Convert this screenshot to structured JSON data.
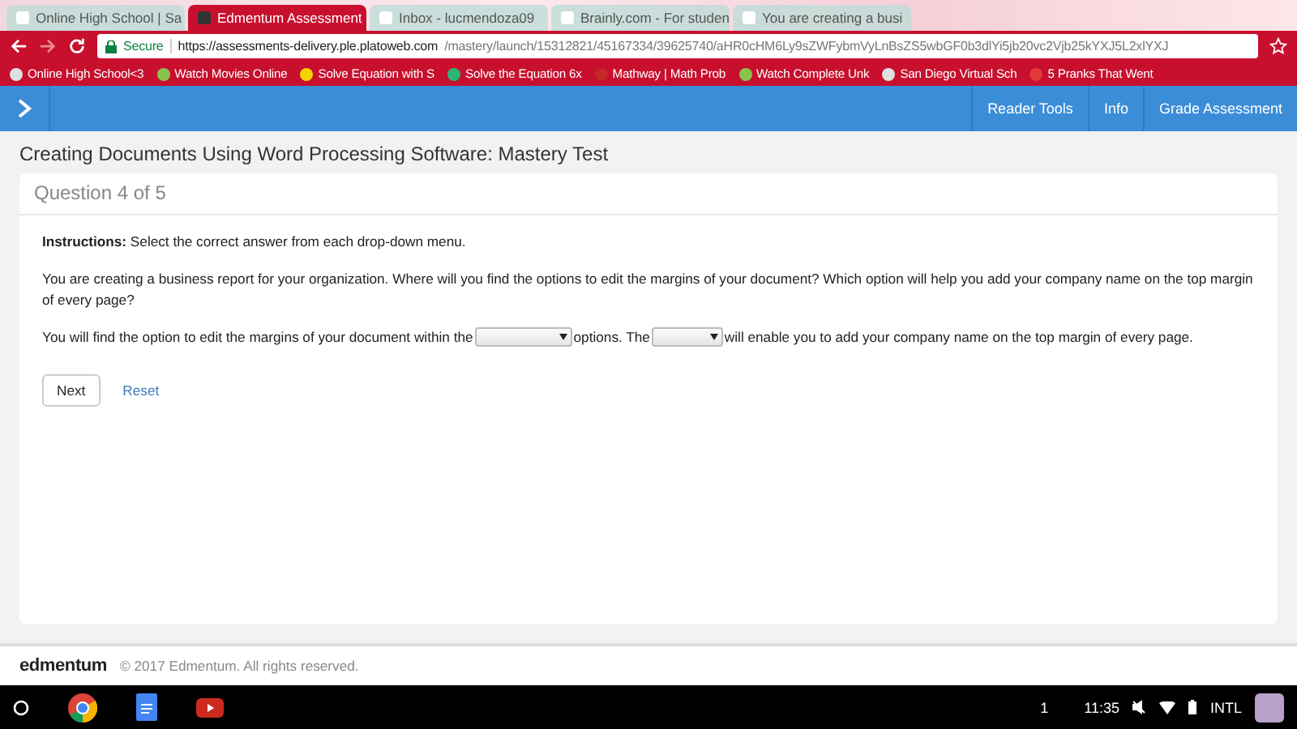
{
  "browser": {
    "tabs": [
      {
        "title": "Online High School | Sa",
        "selected": false
      },
      {
        "title": "Edmentum Assessment",
        "selected": true
      },
      {
        "title": "Inbox - lucmendoza09",
        "selected": false
      },
      {
        "title": "Brainly.com - For studen",
        "selected": false
      },
      {
        "title": "You are creating a busi",
        "selected": false
      }
    ],
    "secure_label": "Secure",
    "url_host": "https://assessments-delivery.ple.platoweb.com",
    "url_path": "/mastery/launch/15312821/45167334/39625740/aHR0cHM6Ly9sZWFybmVyLnBsZS5wbGF0b3dlYi5jb20vc2Vjb25kYXJ5L2xlYXJ",
    "bookmarks": [
      {
        "label": "Online High School<3",
        "color": "#e0e0e0"
      },
      {
        "label": "Watch Movies Online",
        "color": "#8bc34a"
      },
      {
        "label": "Solve Equation with S",
        "color": "#f5d300"
      },
      {
        "label": "Solve the Equation 6x",
        "color": "#2bb673"
      },
      {
        "label": "Mathway | Math Prob",
        "color": "#c62828"
      },
      {
        "label": "Watch Complete Unk",
        "color": "#8bc34a"
      },
      {
        "label": "San Diego Virtual Sch",
        "color": "#e0e0e0"
      },
      {
        "label": "5 Pranks That Went",
        "color": "#e53935"
      }
    ]
  },
  "app_bar": {
    "menu": [
      "Reader Tools",
      "Info",
      "Grade Assessment"
    ]
  },
  "page_title": "Creating Documents Using Word Processing Software: Mastery Test",
  "question": {
    "heading": "Question 4 of 5",
    "instructions": "**Instructions:** Select the correct answer from each drop-down menu.",
    "prompt": "You are creating a business report for your organization. Where will you find the options to edit the margins of your document? Which option will help you add your company name on the top margin of every page?",
    "sentence": [
      {
        "kind": "text",
        "text": "You will find the option to edit the margins of your document within the"
      },
      {
        "kind": "dropdown"
      },
      {
        "kind": "text",
        "text": "options. The"
      },
      {
        "kind": "dropdown"
      },
      {
        "kind": "text",
        "text": "will enable you to add your company name on the top margin of every page."
      }
    ],
    "buttons": [
      "Next",
      "Reset"
    ]
  },
  "footer": {
    "logo": "edmentum",
    "copyright": "© 2017 Edmentum. All rights reserved."
  },
  "taskbar": {
    "notifications": "1",
    "time": "11:35",
    "input_method": "INTL"
  }
}
